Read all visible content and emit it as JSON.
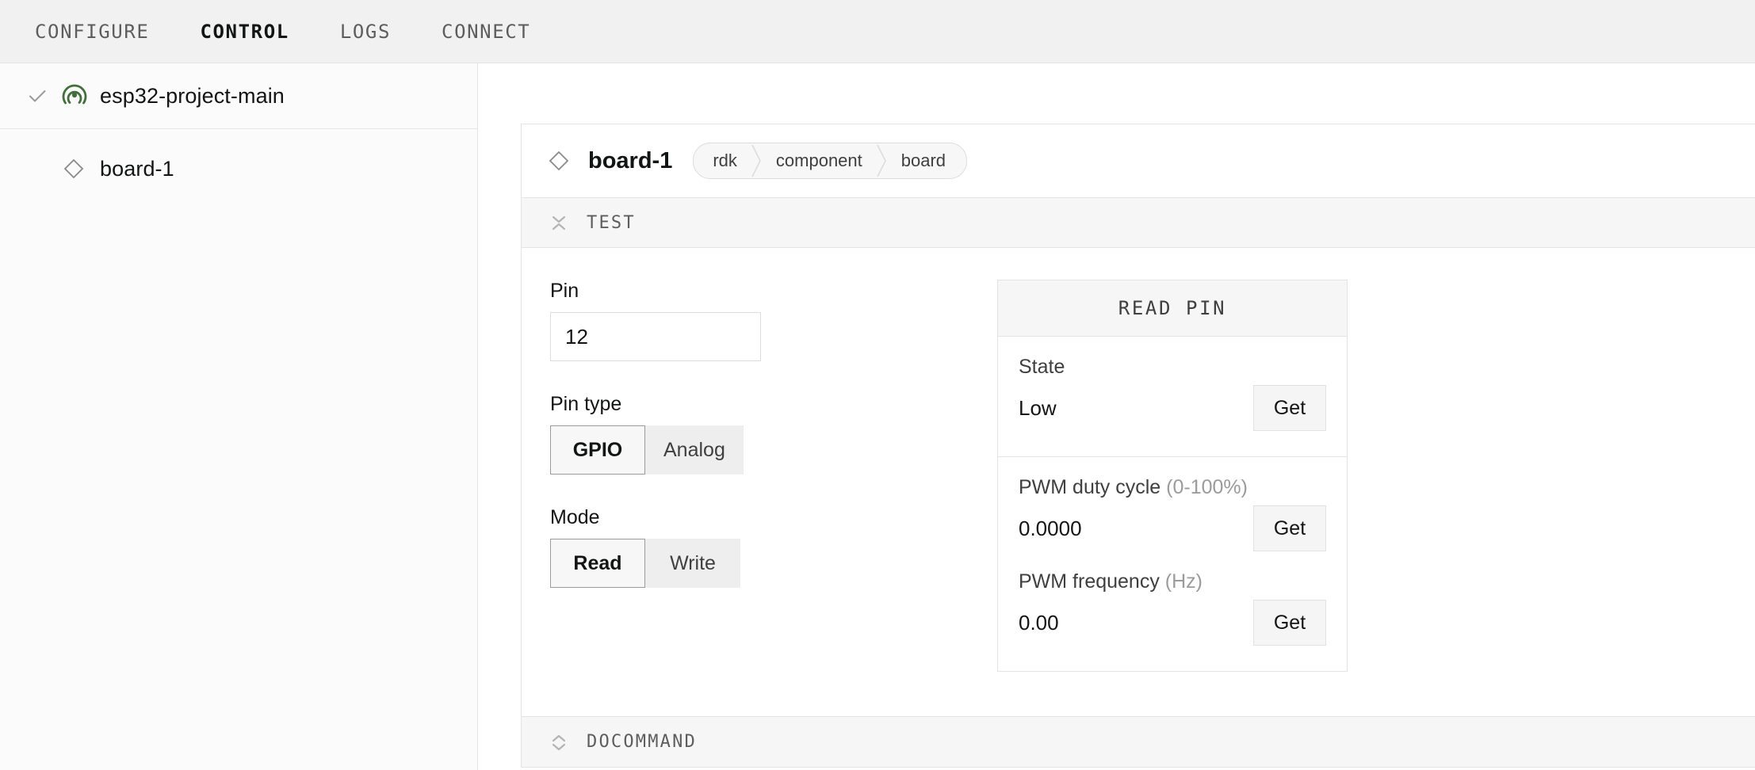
{
  "topnav": {
    "tabs": [
      {
        "label": "CONFIGURE",
        "active": false
      },
      {
        "label": "CONTROL",
        "active": true
      },
      {
        "label": "LOGS",
        "active": false
      },
      {
        "label": "CONNECT",
        "active": false
      }
    ]
  },
  "sidebar": {
    "project": {
      "label": "esp32-project-main",
      "check_icon": "check-icon",
      "status_icon": "signal-icon",
      "status_color": "#41703b"
    },
    "child": {
      "label": "board-1",
      "icon": "diamond-icon"
    }
  },
  "panel": {
    "icon": "diamond-icon",
    "title": "board-1",
    "breadcrumbs": [
      "rdk",
      "component",
      "board"
    ],
    "sections": [
      {
        "label": "TEST",
        "icon": "collapse-icon",
        "expanded": true
      },
      {
        "label": "DOCOMMAND",
        "icon": "expand-icon",
        "expanded": false
      }
    ]
  },
  "form": {
    "pin_label": "Pin",
    "pin_value": "12",
    "pin_placeholder": "",
    "pin_type_label": "Pin type",
    "pin_type_options": [
      "GPIO",
      "Analog"
    ],
    "pin_type_selected": "GPIO",
    "mode_label": "Mode",
    "mode_options": [
      "Read",
      "Write"
    ],
    "mode_selected": "Read"
  },
  "read_pin_card": {
    "title": "READ PIN",
    "rows": [
      {
        "label": "State",
        "unit": "",
        "value": "Low",
        "button": "Get"
      },
      {
        "label": "PWM duty cycle ",
        "unit": "(0-100%)",
        "value": "0.0000",
        "button": "Get"
      },
      {
        "label": "PWM frequency ",
        "unit": "(Hz)",
        "value": "0.00",
        "button": "Get"
      }
    ]
  }
}
